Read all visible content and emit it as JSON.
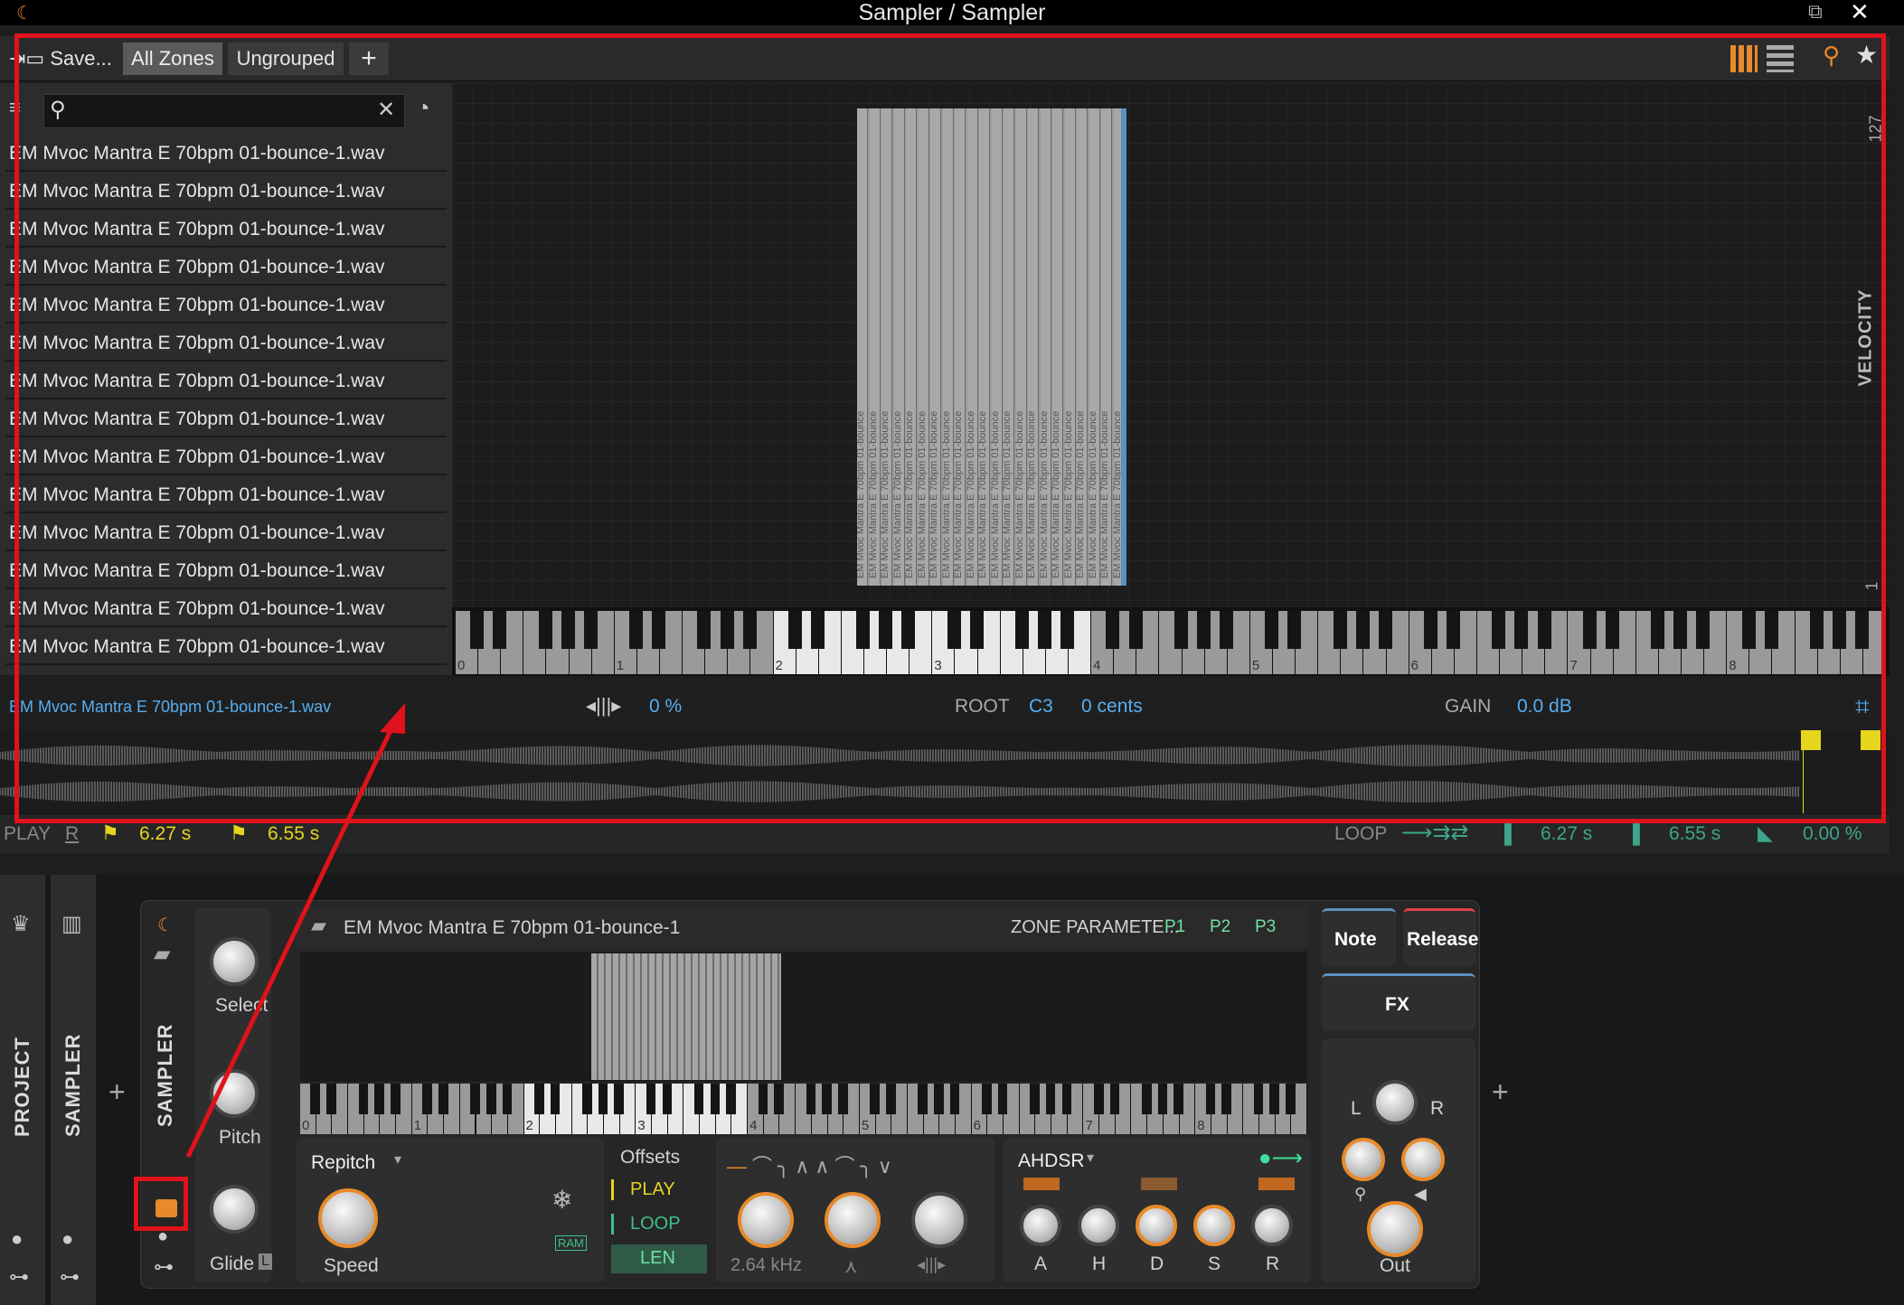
{
  "window": {
    "title": "Sampler / Sampler"
  },
  "toolbar": {
    "save_label": "Save...",
    "all_zones": "All Zones",
    "ungrouped": "Ungrouped",
    "add": "+"
  },
  "browser": {
    "items": [
      "EM Mvoc Mantra E 70bpm 01-bounce-1.wav",
      "EM Mvoc Mantra E 70bpm 01-bounce-1.wav",
      "EM Mvoc Mantra E 70bpm 01-bounce-1.wav",
      "EM Mvoc Mantra E 70bpm 01-bounce-1.wav",
      "EM Mvoc Mantra E 70bpm 01-bounce-1.wav",
      "EM Mvoc Mantra E 70bpm 01-bounce-1.wav",
      "EM Mvoc Mantra E 70bpm 01-bounce-1.wav",
      "EM Mvoc Mantra E 70bpm 01-bounce-1.wav",
      "EM Mvoc Mantra E 70bpm 01-bounce-1.wav",
      "EM Mvoc Mantra E 70bpm 01-bounce-1.wav",
      "EM Mvoc Mantra E 70bpm 01-bounce-1.wav",
      "EM Mvoc Mantra E 70bpm 01-bounce-1.wav",
      "EM Mvoc Mantra E 70bpm 01-bounce-1.wav",
      "EM Mvoc Mantra E 70bpm 01-bounce-1.wav"
    ]
  },
  "zonemap": {
    "velocity_label": "VELOCITY",
    "vel_max": "127",
    "vel_min": "1",
    "zone_text": "EM Mvoc Mantra E 70bpm 01-bounce",
    "octaves": [
      "0",
      "1",
      "2",
      "3",
      "4",
      "5",
      "6",
      "7",
      "8"
    ]
  },
  "sample": {
    "name": "EM Mvoc Mantra E 70bpm 01-bounce-1.wav",
    "stretch": "0 %",
    "root_label": "ROOT",
    "root": "C3",
    "cents": "0 cents",
    "gain_label": "GAIN",
    "gain": "0.0 dB"
  },
  "playbar": {
    "play_label": "PLAY",
    "r_label": "R",
    "play_start": "6.27 s",
    "play_end": "6.55 s",
    "loop_label": "LOOP",
    "loop_start": "6.27 s",
    "loop_end": "6.55 s",
    "loop_xfade": "0.00 %"
  },
  "chain": {
    "project_tab": "PROJECT",
    "sampler_tab": "SAMPLER",
    "device_tab": "SAMPLER",
    "add": "+"
  },
  "device": {
    "select_label": "Select",
    "pitch_label": "Pitch",
    "glide_label": "Glide",
    "glide_badge": "L",
    "zone_name": "EM Mvoc Mantra E 70bpm 01-bounce-1",
    "zone_params": "ZONE PARAMETE...",
    "p1": "P1",
    "p2": "P2",
    "p3": "P3",
    "note_btn": "Note",
    "release_btn": "Release",
    "fx_btn": "FX",
    "mini_octaves": [
      "0",
      "1",
      "2",
      "3",
      "4",
      "5",
      "6",
      "7",
      "8"
    ],
    "repitch": "Repitch",
    "speed_label": "Speed",
    "offsets": "Offsets",
    "play": "PLAY",
    "loop": "LOOP",
    "len": "LEN",
    "ram": "RAM",
    "filter_freq": "2.64 kHz",
    "env_mode": "AHDSR",
    "env_labels": [
      "A",
      "H",
      "D",
      "S",
      "R"
    ],
    "l_label": "L",
    "r_label": "R",
    "out_label": "Out"
  },
  "colors": {
    "accent_orange": "#e88a2a",
    "value_blue": "#56aef2",
    "time_yellow": "#e6d51d",
    "annotation_red": "#e0121b"
  }
}
